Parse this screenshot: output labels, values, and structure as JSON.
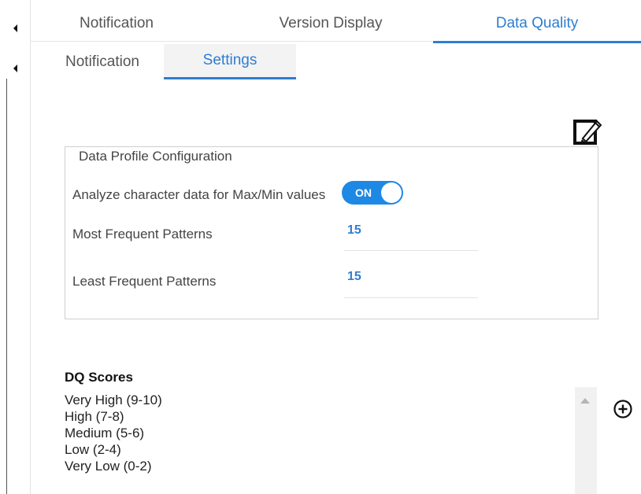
{
  "tabs_row1": [
    {
      "label": "Notification",
      "active": false
    },
    {
      "label": "Version Display",
      "active": false
    },
    {
      "label": "Data Quality",
      "active": true
    }
  ],
  "tabs_row2": [
    {
      "label": "Notification",
      "active": false
    },
    {
      "label": "Settings",
      "active": true
    }
  ],
  "data_profile": {
    "legend": "Data Profile Configuration",
    "analyze_label": "Analyze character data for Max/Min values",
    "analyze_toggle": "ON",
    "most_frequent_label": "Most Frequent Patterns",
    "most_frequent_value": "15",
    "least_frequent_label": "Least Frequent Patterns",
    "least_frequent_value": "15"
  },
  "dq_scores": {
    "title": "DQ Scores",
    "items": [
      "Very High (9-10)",
      "High (7-8)",
      "Medium (5-6)",
      "Low (2-4)",
      "Very Low (0-2)"
    ]
  },
  "icons": {
    "edit": "pencil-edit-icon",
    "add": "plus-circle-icon",
    "collapse": "caret-left-icon"
  },
  "colors": {
    "accent": "#2f7dd1",
    "toggle_on": "#1e88e5"
  }
}
